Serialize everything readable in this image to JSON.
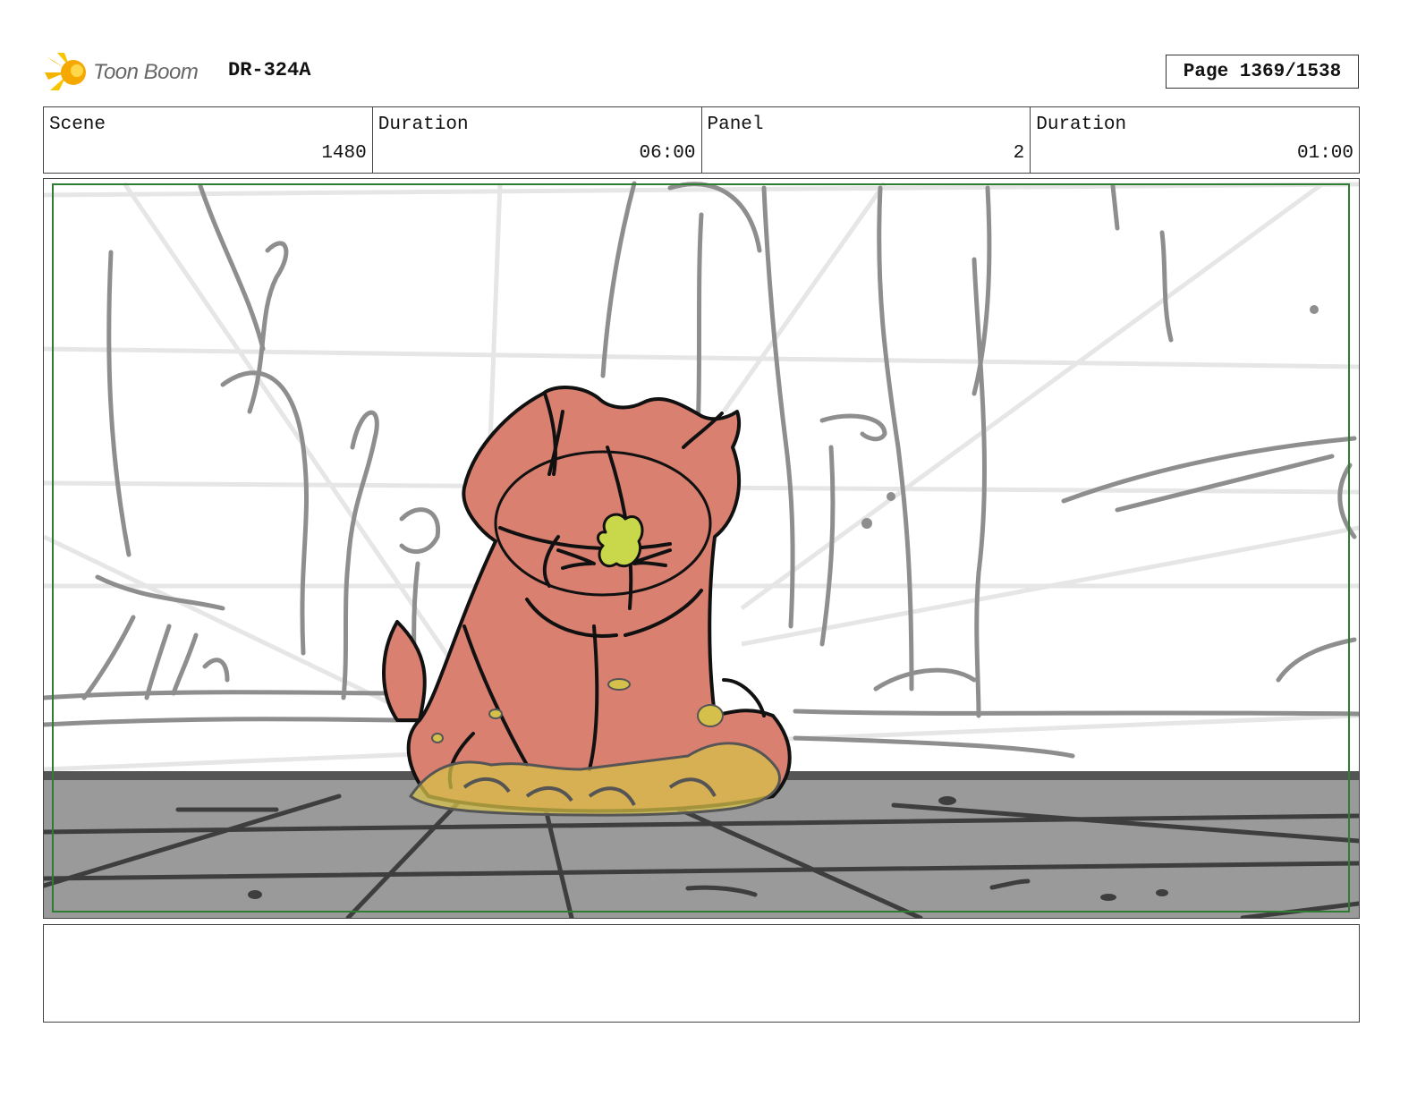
{
  "header": {
    "logo_text": "Toon Boom",
    "project_code": "DR-324A",
    "page_label": "Page 1369/1538"
  },
  "info": {
    "scene_label": "Scene",
    "scene_value": "1480",
    "scene_duration_label": "Duration",
    "scene_duration_value": "06:00",
    "panel_label": "Panel",
    "panel_value": "2",
    "panel_duration_label": "Duration",
    "panel_duration_value": "01:00"
  },
  "colors": {
    "character_fill": "#d98070",
    "safe_frame": "#2e7d32",
    "floor": "#9a9a9a",
    "logo_accent": "#f5b400"
  },
  "icons": {
    "logo": "toon-boom-star-icon"
  },
  "notes": ""
}
